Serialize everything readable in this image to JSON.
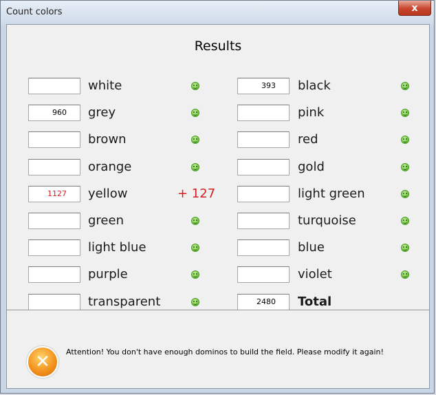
{
  "window": {
    "title": "Count colors",
    "close_glyph": "x"
  },
  "heading": "Results",
  "colors_left": [
    {
      "label": "white",
      "value": "",
      "status": "ok"
    },
    {
      "label": "grey",
      "value": "960",
      "status": "ok"
    },
    {
      "label": "brown",
      "value": "",
      "status": "ok"
    },
    {
      "label": "orange",
      "value": "",
      "status": "ok"
    },
    {
      "label": "yellow",
      "value": "1127",
      "status": "over",
      "delta": "+ 127"
    },
    {
      "label": "green",
      "value": "",
      "status": "ok"
    },
    {
      "label": "light blue",
      "value": "",
      "status": "ok"
    },
    {
      "label": "purple",
      "value": "",
      "status": "ok"
    },
    {
      "label": "transparent",
      "value": "",
      "status": "ok"
    }
  ],
  "colors_right": [
    {
      "label": "black",
      "value": "393",
      "status": "ok"
    },
    {
      "label": "pink",
      "value": "",
      "status": "ok"
    },
    {
      "label": "red",
      "value": "",
      "status": "ok"
    },
    {
      "label": "gold",
      "value": "",
      "status": "ok"
    },
    {
      "label": "light green",
      "value": "",
      "status": "ok"
    },
    {
      "label": "turquoise",
      "value": "",
      "status": "ok"
    },
    {
      "label": "blue",
      "value": "",
      "status": "ok"
    },
    {
      "label": "violet",
      "value": "",
      "status": "ok"
    }
  ],
  "total": {
    "label": "Total",
    "value": "2480"
  },
  "footer": {
    "icon": "warning-icon",
    "icon_glyph": "✕",
    "message": "Attention! You don't have enough dominos to build the field. Please modify it again!"
  },
  "colors": {
    "ok": "#6cc436",
    "warn": "#d21e1e",
    "warning_icon": "#f3931e"
  }
}
